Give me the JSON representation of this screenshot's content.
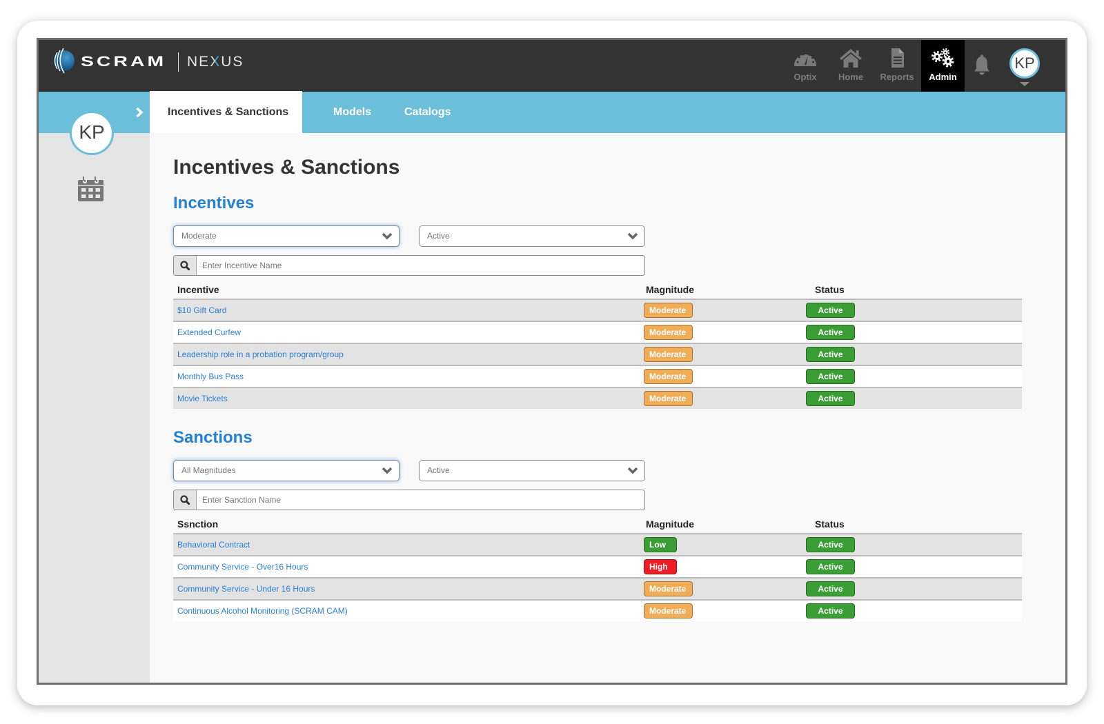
{
  "brand": {
    "name": "SCRAM",
    "product": "NEXUS"
  },
  "topnav": {
    "items": [
      {
        "label": "Optix",
        "icon": "gauge-icon"
      },
      {
        "label": "Home",
        "icon": "home-icon"
      },
      {
        "label": "Reports",
        "icon": "document-icon"
      },
      {
        "label": "Admin",
        "icon": "gears-icon",
        "active": true
      }
    ],
    "notifications_icon": "bell-icon",
    "user_initials": "KP"
  },
  "subnav": {
    "tabs": [
      {
        "label": "Incentives & Sanctions",
        "active": true
      },
      {
        "label": "Models"
      },
      {
        "label": "Catalogs"
      }
    ]
  },
  "sidebar": {
    "user_initials": "KP",
    "toggle_icon": "chevron-right-icon",
    "items": [
      {
        "icon": "calendar-icon"
      }
    ]
  },
  "page": {
    "title": "Incentives & Sanctions"
  },
  "incentives": {
    "heading": "Incentives",
    "magnitude_filter": "Moderate",
    "status_filter": "Active",
    "search_placeholder": "Enter Incentive Name",
    "columns": [
      "Incentive",
      "Magnitude",
      "Status"
    ],
    "rows": [
      {
        "name": "$10 Gift Card",
        "magnitude": "Moderate",
        "status": "Active"
      },
      {
        "name": "Extended Curfew",
        "magnitude": "Moderate",
        "status": "Active"
      },
      {
        "name": "Leadership role in a probation program/group",
        "magnitude": "Moderate",
        "status": "Active"
      },
      {
        "name": "Monthly Bus Pass",
        "magnitude": "Moderate",
        "status": "Active"
      },
      {
        "name": "Movie Tickets",
        "magnitude": "Moderate",
        "status": "Active"
      }
    ]
  },
  "sanctions": {
    "heading": "Sanctions",
    "magnitude_filter": "All Magnitudes",
    "status_filter": "Active",
    "search_placeholder": "Enter Sanction Name",
    "columns": [
      "Ssnction",
      "Magnitude",
      "Status"
    ],
    "rows": [
      {
        "name": "Behavioral Contract",
        "magnitude": "Low",
        "status": "Active"
      },
      {
        "name": "Community Service - Over16 Hours",
        "magnitude": "High",
        "status": "Active"
      },
      {
        "name": "Community Service - Under 16 Hours",
        "magnitude": "Moderate",
        "status": "Active"
      },
      {
        "name": "Continuous Alcohol Monitoring (SCRAM CAM)",
        "magnitude": "Moderate",
        "status": "Active"
      }
    ]
  },
  "colors": {
    "header_bg": "#333333",
    "accent_blue": "#6bbfdb",
    "heading_blue": "#2680d1",
    "link": "#2a7fd4",
    "magnitude": {
      "moderate": "#f0ad57",
      "low": "#3a9e35",
      "high": "#ee1c25"
    },
    "status": {
      "active": "#3a9e35"
    }
  }
}
